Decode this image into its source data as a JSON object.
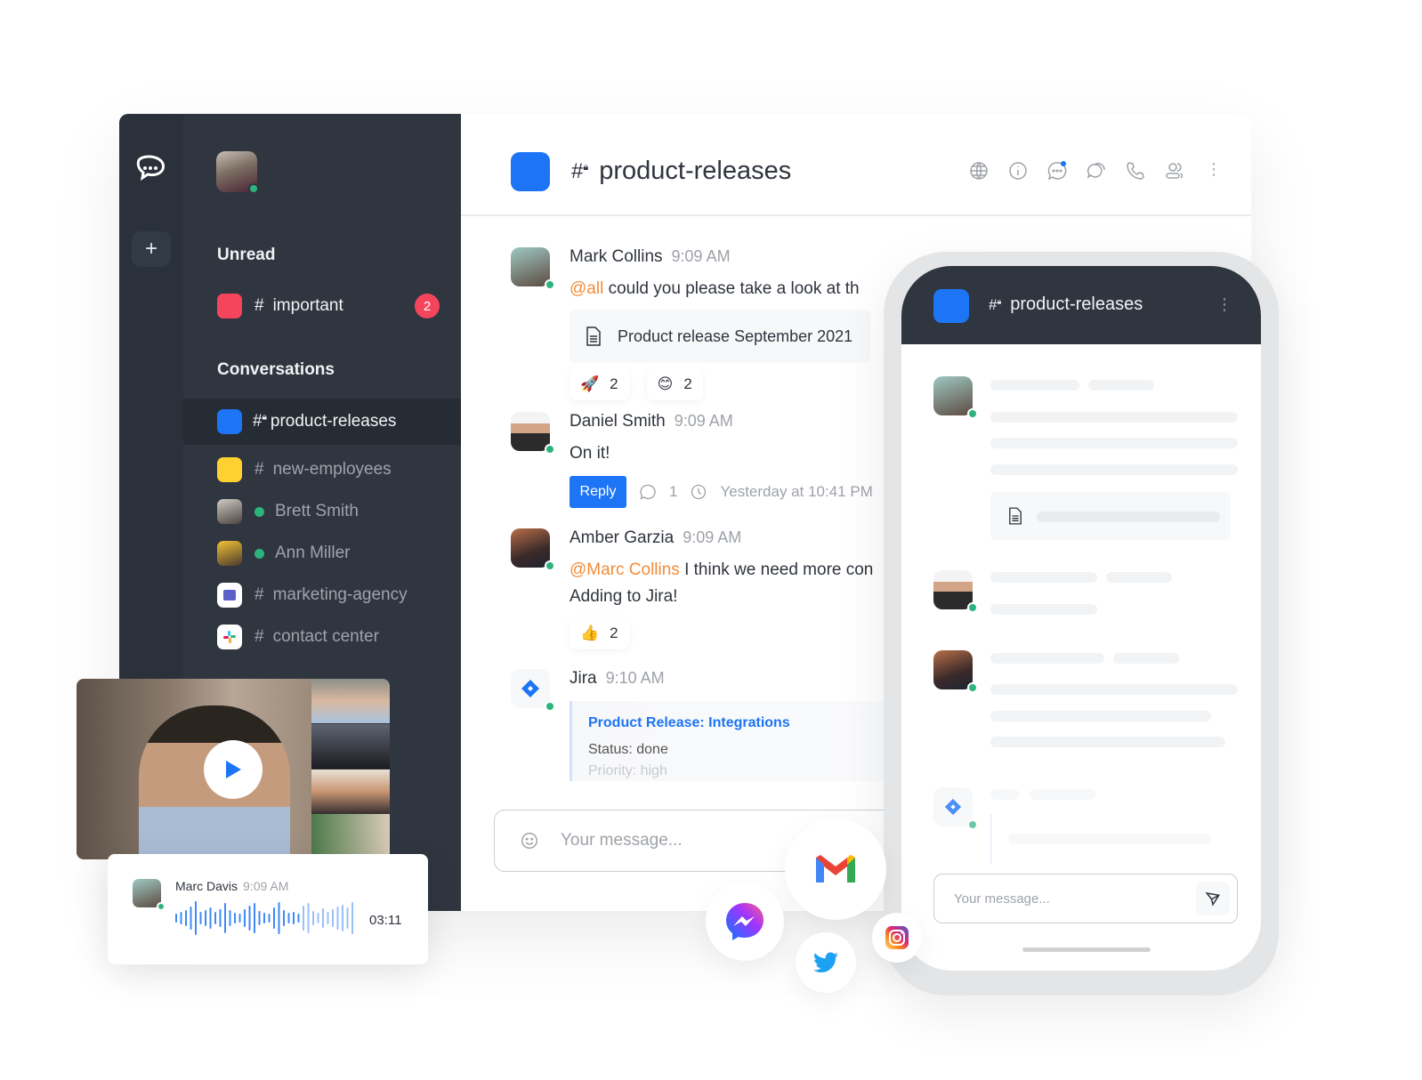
{
  "sidebar": {
    "sections": {
      "unread": "Unread",
      "conversations": "Conversations"
    },
    "unread_rooms": [
      {
        "label": "important",
        "prefix": "#",
        "color": "#f5455c",
        "badge": "2"
      }
    ],
    "rooms": [
      {
        "label": "product-releases",
        "prefix": "#",
        "type": "private-channel",
        "color": "#1d74f5",
        "active": true
      },
      {
        "label": "new-employees",
        "prefix": "#",
        "type": "channel",
        "color": "#ffd031"
      },
      {
        "label": "Brett Smith",
        "type": "direct",
        "status": "online"
      },
      {
        "label": "Ann Miller",
        "type": "direct",
        "status": "online"
      },
      {
        "label": "marketing-agency",
        "prefix": "#",
        "type": "channel",
        "icon": "teams-icon"
      },
      {
        "label": "contact center",
        "prefix": "#",
        "type": "channel",
        "icon": "slack-icon"
      }
    ],
    "add_label": "+"
  },
  "header": {
    "title": "product-releases",
    "icons": [
      "globe-icon",
      "info-icon",
      "discussion-icon",
      "threads-icon",
      "phone-icon",
      "members-icon",
      "kebab-icon"
    ]
  },
  "messages": [
    {
      "author": "Mark Collins",
      "time": "9:09 AM",
      "mention": "@all",
      "text": " could you please take a look at th",
      "attachment": "Product release September 2021",
      "reactions": [
        {
          "emoji": "🚀",
          "count": "2"
        },
        {
          "emoji": "😊",
          "count": "2"
        }
      ]
    },
    {
      "author": "Daniel Smith",
      "time": "9:09 AM",
      "text": "On it!",
      "reply_label": "Reply",
      "thread_count": "1",
      "last_reply": "Yesterday at 10:41 PM"
    },
    {
      "author": "Amber Garzia",
      "time": "9:09 AM",
      "mention": "@Marc Collins",
      "text": " I think we need more con",
      "text2": "Adding to Jira!",
      "reactions": [
        {
          "emoji": "👍",
          "count": "2"
        }
      ]
    },
    {
      "author": "Jira",
      "time": "9:10 AM",
      "card": {
        "title": "Product Release: Integrations",
        "status": "Status: done",
        "priority": "Priority: high"
      }
    }
  ],
  "composer": {
    "placeholder": "Your message..."
  },
  "phone": {
    "title": "product-releases",
    "composer_placeholder": "Your message..."
  },
  "audio_message": {
    "author": "Marc Davis",
    "time": "9:09 AM",
    "duration": "03:11"
  },
  "integrations": [
    "gmail-icon",
    "messenger-icon",
    "twitter-icon",
    "instagram-icon"
  ],
  "colors": {
    "accent": "#1d74f5",
    "sidebar": "#2f3640",
    "online": "#2db47d",
    "badge": "#f5455c",
    "mention": "#f38c39"
  }
}
